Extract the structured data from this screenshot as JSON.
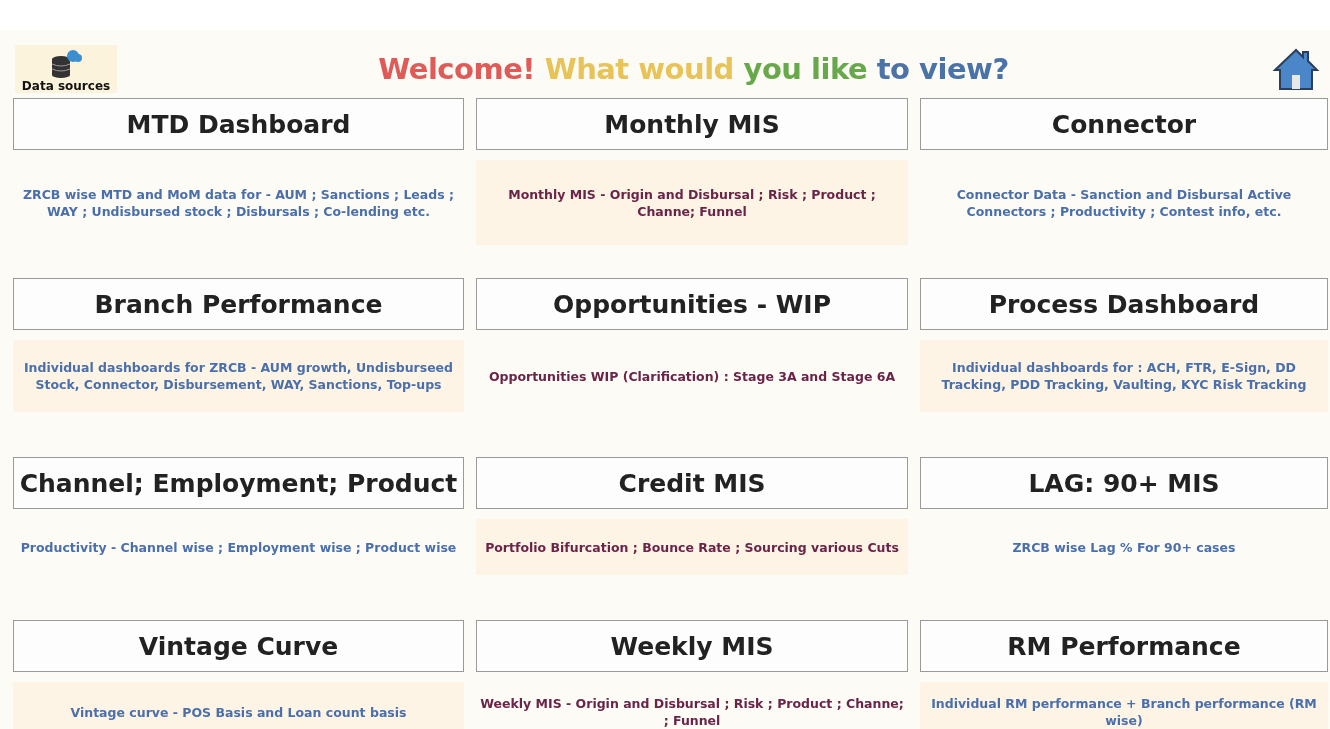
{
  "data_sources": {
    "label": "Data sources"
  },
  "heading": [
    {
      "text": "Welcome!",
      "color": "#e05a58"
    },
    {
      "text": "What would",
      "color": "#e8c358"
    },
    {
      "text": "you like",
      "color": "#67a84b"
    },
    {
      "text": "to view?",
      "color": "#4a73a8"
    }
  ],
  "tiles": [
    {
      "title": "MTD Dashboard",
      "description": "ZRCB wise MTD and MoM data for - AUM ; Sanctions ; Leads ; WAY ; Undisbursed stock ; Disbursals ; Co-lending etc.",
      "color": "#4a6fab",
      "shaded": false
    },
    {
      "title": "Monthly MIS",
      "description": "Monthly MIS - Origin and Disbursal ; Risk ; Product ; Channe; Funnel",
      "color": "#6a2448",
      "shaded": true
    },
    {
      "title": "Connector",
      "description": "Connector Data - Sanction and Disbursal Active Connectors ; Productivity ; Contest info, etc.",
      "color": "#4a6fab",
      "shaded": false
    },
    {
      "title": "Branch Performance",
      "description": "Individual dashboards for ZRCB - AUM growth, Undisburseed Stock, Connector, Disbursement, WAY, Sanctions, Top-ups",
      "color": "#4a6fab",
      "shaded": true
    },
    {
      "title": "Opportunities - WIP",
      "description": "Opportunities WIP (Clarification) : Stage 3A and Stage 6A",
      "color": "#6a2448",
      "shaded": false
    },
    {
      "title": "Process Dashboard",
      "description": "Individual dashboards for : ACH, FTR, E-Sign, DD Tracking, PDD Tracking, Vaulting, KYC Risk Tracking",
      "color": "#4a6fab",
      "shaded": true
    },
    {
      "title": "Channel; Employment; Product",
      "description": "Productivity - Channel wise ; Employment wise ; Product wise",
      "color": "#4a6fab",
      "shaded": false
    },
    {
      "title": "Credit MIS",
      "description": "Portfolio Bifurcation ;  Bounce Rate ;  Sourcing various Cuts",
      "color": "#6a2448",
      "shaded": true
    },
    {
      "title": "LAG: 90+ MIS",
      "description": "ZRCB wise Lag % For 90+ cases",
      "color": "#4a6fab",
      "shaded": false
    },
    {
      "title": "Vintage Curve",
      "description": "Vintage curve - POS Basis and Loan count basis",
      "color": "#4a6fab",
      "shaded": true
    },
    {
      "title": "Weekly MIS",
      "description": "Weekly MIS - Origin and Disbursal ; Risk ; Product ; Channe; ; Funnel",
      "color": "#6a2448",
      "shaded": false
    },
    {
      "title": "RM Performance",
      "description": "Individual RM performance + Branch performance (RM wise)",
      "color": "#4a6fab",
      "shaded": true
    }
  ]
}
